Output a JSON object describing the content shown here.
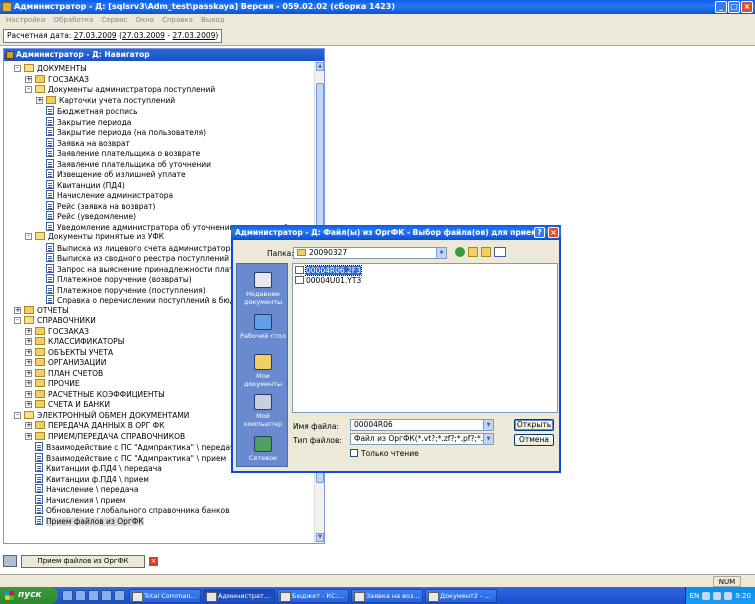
{
  "main_window": {
    "title": "Администратор - Д: [sqlsrv3\\Adm_test\\passkaya] Версия - 059.02.02 (сборка 1423)"
  },
  "menu": [
    "Настройки",
    "Обработка",
    "Сервис",
    "Окна",
    "Справка",
    "Выход"
  ],
  "date_bar": {
    "label": "Расчетная дата:",
    "date": "27.03.2009",
    "open": "(",
    "range_from": "27.03.2009",
    "sep": "-",
    "range_to": "27.03.2009",
    "close": ")"
  },
  "navigator": {
    "title": "Администратор - Д: Навигатор",
    "items": [
      {
        "label": "ДОКУМЕНТЫ",
        "level": 0,
        "type": "folder-open",
        "exp": "-"
      },
      {
        "label": "ГОСЗАКАЗ",
        "level": 1,
        "type": "folder",
        "exp": "+"
      },
      {
        "label": "Документы администратора поступлений",
        "level": 1,
        "type": "folder-open",
        "exp": "-"
      },
      {
        "label": "Карточки учета поступлений",
        "level": 2,
        "type": "folder",
        "exp": "+"
      },
      {
        "label": "Бюджетная роспись",
        "level": 2,
        "type": "doc",
        "exp": ""
      },
      {
        "label": "Закрытие периода",
        "level": 2,
        "type": "doc",
        "exp": ""
      },
      {
        "label": "Закрытие периода (на пользователя)",
        "level": 2,
        "type": "doc",
        "exp": ""
      },
      {
        "label": "Заявка на возврат",
        "level": 2,
        "type": "doc",
        "exp": ""
      },
      {
        "label": "Заявление плательщика о возврате",
        "level": 2,
        "type": "doc",
        "exp": ""
      },
      {
        "label": "Заявление плательщика об уточнении",
        "level": 2,
        "type": "doc",
        "exp": ""
      },
      {
        "label": "Извещение об излишней уплате",
        "level": 2,
        "type": "doc",
        "exp": ""
      },
      {
        "label": "Квитанции (ПД4)",
        "level": 2,
        "type": "doc",
        "exp": ""
      },
      {
        "label": "Начисление администратора",
        "level": 2,
        "type": "doc",
        "exp": ""
      },
      {
        "label": "Рейс (заявка на возврат)",
        "level": 2,
        "type": "doc",
        "exp": ""
      },
      {
        "label": "Рейс (уведомление)",
        "level": 2,
        "type": "doc",
        "exp": ""
      },
      {
        "label": "Уведомление администратора об уточнении поступлений",
        "level": 2,
        "type": "doc",
        "exp": ""
      },
      {
        "label": "Документы принятые из УФК",
        "level": 1,
        "type": "folder-open",
        "exp": "-"
      },
      {
        "label": "Выписка из лицевого счета администратора поступлений",
        "level": 2,
        "type": "doc",
        "exp": ""
      },
      {
        "label": "Выписка из сводного реестра поступлений и выбытий",
        "level": 2,
        "type": "doc",
        "exp": ""
      },
      {
        "label": "Запрос на выяснение принадлежности платежа",
        "level": 2,
        "type": "doc",
        "exp": ""
      },
      {
        "label": "Платежное поручение (возвраты)",
        "level": 2,
        "type": "doc",
        "exp": ""
      },
      {
        "label": "Платежное поручение (поступления)",
        "level": 2,
        "type": "doc",
        "exp": ""
      },
      {
        "label": "Справка о перечислении поступлений в бюджеты",
        "level": 2,
        "type": "doc",
        "exp": ""
      },
      {
        "label": "ОТЧЕТЫ",
        "level": 0,
        "type": "folder",
        "exp": "+"
      },
      {
        "label": "СПРАВОЧНИКИ",
        "level": 0,
        "type": "folder-open",
        "exp": "-"
      },
      {
        "label": "ГОСЗАКАЗ",
        "level": 1,
        "type": "folder",
        "exp": "+"
      },
      {
        "label": "КЛАССИФИКАТОРЫ",
        "level": 1,
        "type": "folder",
        "exp": "+"
      },
      {
        "label": "ОБЪЕКТЫ УЧЕТА",
        "level": 1,
        "type": "folder",
        "exp": "+"
      },
      {
        "label": "ОРГАНИЗАЦИИ",
        "level": 1,
        "type": "folder",
        "exp": "+"
      },
      {
        "label": "ПЛАН СЧЕТОВ",
        "level": 1,
        "type": "folder",
        "exp": "+"
      },
      {
        "label": "ПРОЧИЕ",
        "level": 1,
        "type": "folder",
        "exp": "+"
      },
      {
        "label": "РАСЧЕТНЫЕ КОЭФФИЦИЕНТЫ",
        "level": 1,
        "type": "folder",
        "exp": "+"
      },
      {
        "label": "СЧЕТА И БАНКИ",
        "level": 1,
        "type": "folder",
        "exp": "+"
      },
      {
        "label": "ЭЛЕКТРОННЫЙ ОБМЕН ДОКУМЕНТАМИ",
        "level": 0,
        "type": "folder-open",
        "exp": "-"
      },
      {
        "label": "ПЕРЕДАЧА ДАННЫХ В ОРГ ФК",
        "level": 1,
        "type": "folder",
        "exp": "+"
      },
      {
        "label": "ПРИЕМ/ПЕРЕДАЧА СПРАВОЧНИКОВ",
        "level": 1,
        "type": "folder",
        "exp": "+"
      },
      {
        "label": "Взаимодействие с ПС \"Адмпрактика\" \\ передача",
        "level": 1,
        "type": "doc",
        "exp": ""
      },
      {
        "label": "Взаимодействие с ПС \"Адмпрактика\" \\ прием",
        "level": 1,
        "type": "doc",
        "exp": ""
      },
      {
        "label": "Квитанции ф.ПД4 \\ передача",
        "level": 1,
        "type": "doc",
        "exp": ""
      },
      {
        "label": "Квитанции ф.ПД4 \\ прием",
        "level": 1,
        "type": "doc",
        "exp": ""
      },
      {
        "label": "Начисление \\ передача",
        "level": 1,
        "type": "doc",
        "exp": ""
      },
      {
        "label": "Начисления \\ прием",
        "level": 1,
        "type": "doc",
        "exp": ""
      },
      {
        "label": "Обновление глобального справочника банков",
        "level": 1,
        "type": "doc",
        "exp": ""
      },
      {
        "label": "Прием файлов из ОргФК",
        "level": 1,
        "type": "doc",
        "exp": "",
        "selected": true
      }
    ]
  },
  "window_tab": {
    "label": "Прием файлов из ОргФК"
  },
  "status_bar": {
    "num": "NUM"
  },
  "dialog": {
    "title": "Администратор - Д: Файл(ы) из ОргФК - Выбор файла(ов) для приема",
    "folder_label": "Папка:",
    "folder_value": "20090327",
    "places": [
      "Недавние документы",
      "Рабочий стол",
      "Мои документы",
      "Мой компьютер",
      "Сетевое"
    ],
    "files": [
      {
        "name": "00004R06.2F3",
        "selected": true
      },
      {
        "name": "00004U01.YT3",
        "selected": false
      }
    ],
    "filename_label": "Имя файла:",
    "filename_value": "00004R06",
    "filetype_label": "Тип файлов:",
    "filetype_value": "Файл из ОргФК(*.vt?;*.zf?;*.pf?;*.xe?;*.xr?)",
    "readonly_label": "Только чтение",
    "open_button": "Открыть",
    "cancel_button": "Отмена"
  },
  "taskbar": {
    "start": "пуск",
    "tasks": [
      "Total Comman...",
      "Администрат...",
      "Бюджет - КС:...",
      "Заявка на воз...",
      "Документ2 - ..."
    ],
    "lang": "EN",
    "time": "9:20"
  }
}
